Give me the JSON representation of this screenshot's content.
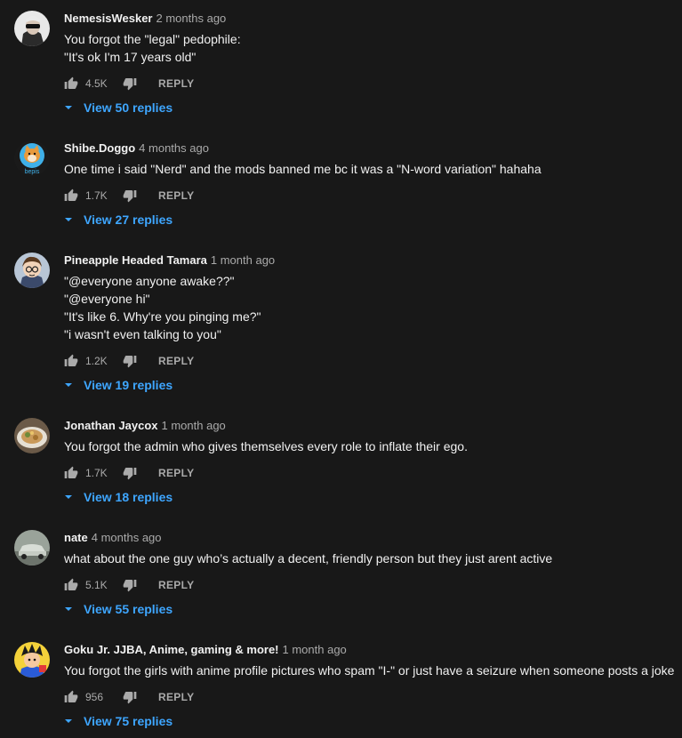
{
  "colors": {
    "background": "#181818",
    "text_primary": "#f1f1f1",
    "text_secondary": "#aaaaaa",
    "link_blue": "#3ea6ff"
  },
  "icons": {
    "like": "thumb-up-icon",
    "dislike": "thumb-down-icon",
    "replies_caret": "caret-down-icon"
  },
  "reply_label": "REPLY",
  "comments": [
    {
      "author": "NemesisWesker",
      "time": "2 months ago",
      "lines": [
        "You forgot the \"legal\" pedophile:",
        "\"It's ok I'm 17 years old\""
      ],
      "likes": "4.5K",
      "view_replies": "View 50 replies",
      "avatar": "masked-man-avatar"
    },
    {
      "author": "Shibe.Doggo",
      "time": "4 months ago",
      "lines": [
        "One time i said \"Nerd\" and the mods banned me bc it was a \"N-word variation\" hahaha"
      ],
      "likes": "1.7K",
      "view_replies": "View 27 replies",
      "avatar": "shiba-dog-avatar",
      "avatar_text": "bepis"
    },
    {
      "author": "Pineapple Headed Tamara",
      "time": "1 month ago",
      "lines": [
        "\"@everyone anyone awake??\"",
        "\"@everyone hi\"",
        "\"It's like 6. Why're you pinging me?\"",
        "\"i wasn't even talking to you\""
      ],
      "likes": "1.2K",
      "view_replies": "View 19 replies",
      "avatar": "cartoon-girl-avatar"
    },
    {
      "author": "Jonathan Jaycox",
      "time": "1 month ago",
      "lines": [
        "You forgot the admin who gives themselves every role to inflate their ego."
      ],
      "likes": "1.7K",
      "view_replies": "View 18 replies",
      "avatar": "food-plate-avatar"
    },
    {
      "author": "nate",
      "time": "4 months ago",
      "lines": [
        "what about the one guy who’s actually a decent, friendly person but they just arent active"
      ],
      "likes": "5.1K",
      "view_replies": "View 55 replies",
      "avatar": "car-photo-avatar"
    },
    {
      "author": "Goku Jr. JJBA, Anime, gaming & more!",
      "time": "1 month ago",
      "lines": [
        "You forgot the girls with anime profile pictures who spam \"I-\" or just have a seizure when someone posts a joke"
      ],
      "likes": "956",
      "view_replies": "View 75 replies",
      "avatar": "anime-character-avatar"
    }
  ]
}
